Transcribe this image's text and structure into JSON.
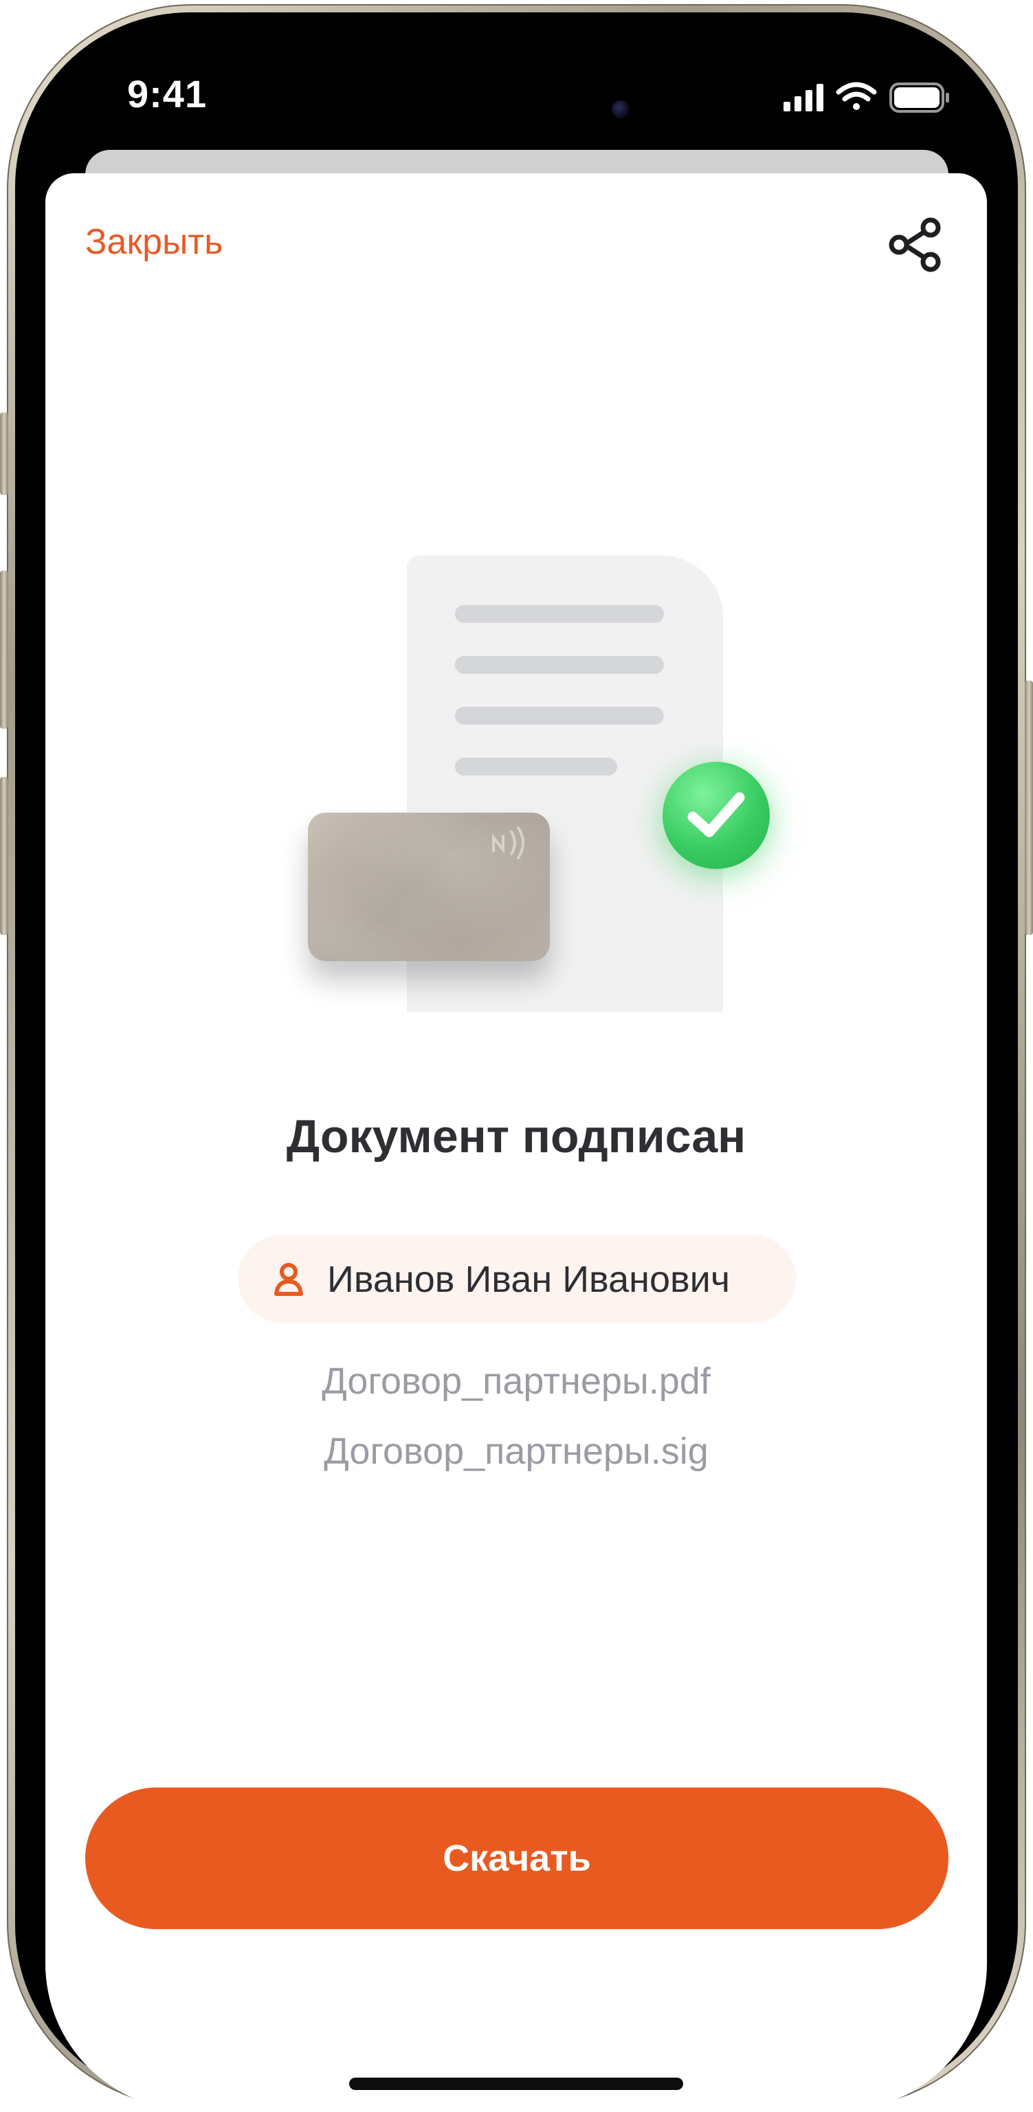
{
  "status_bar": {
    "time": "9:41"
  },
  "header": {
    "close_label": "Закрыть",
    "share_icon": "share-icon"
  },
  "illustration": {
    "document_icon": "document-icon",
    "card_icon": "nfc-card-icon",
    "check_icon": "checkmark-icon"
  },
  "main": {
    "title": "Документ подписан",
    "signer_name": "Иванов Иван Иванович",
    "files": [
      "Договор_партнеры.pdf",
      "Договор_партнеры.sig"
    ]
  },
  "actions": {
    "download_label": "Скачать"
  },
  "colors": {
    "accent": "#e95a20",
    "success": "#39cc62",
    "signer_chip_bg": "#fdf4f0",
    "muted_text": "#9a9ca3",
    "title_text": "#2e2e33"
  }
}
